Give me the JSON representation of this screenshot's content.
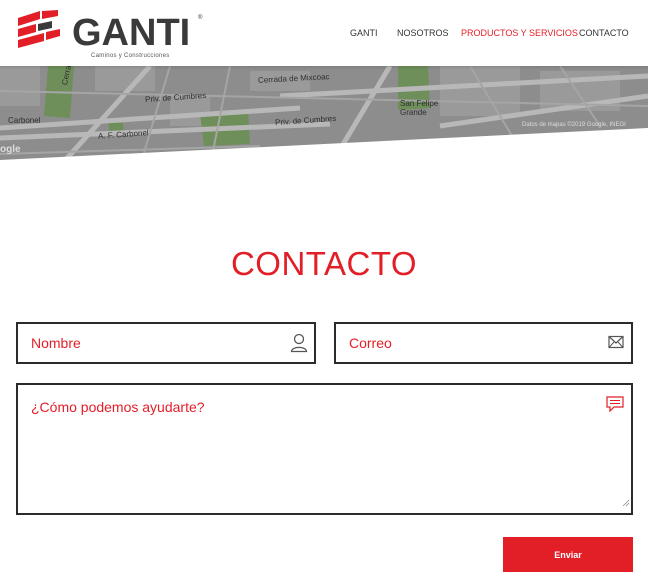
{
  "brand": {
    "name": "GANTI",
    "trademark": "®",
    "tagline": "Caminos y Construcciones",
    "accent_color": "#e21e27",
    "dark_color": "#3a3a3a"
  },
  "nav": {
    "items": [
      {
        "label": "GANTI",
        "active": false
      },
      {
        "label": "NOSOTROS",
        "active": false
      },
      {
        "label": "PRODUCTOS Y SERVICIOS",
        "active": true
      },
      {
        "label": "CONTACTO",
        "active": false
      }
    ]
  },
  "map": {
    "labels": [
      "Cerrada de Magnolias",
      "Priv. de Cumbres",
      "Priv. de Cumbres",
      "Carbonel",
      "A. F. Carbonel",
      "San Felipe Grande",
      "Cerrada de Mixcoac"
    ],
    "attribution": "Datos de mapas ©2019 Google, INEGI",
    "logo_text": "ogle"
  },
  "contact": {
    "title": "CONTACTO",
    "name_placeholder": "Nombre",
    "email_placeholder": "Correo",
    "message_placeholder": "¿Cómo podemos ayudarte?",
    "submit_label": "Enviar"
  },
  "icons": {
    "name_field": "user-icon",
    "email_field": "envelope-icon",
    "message_field": "chat-icon"
  }
}
